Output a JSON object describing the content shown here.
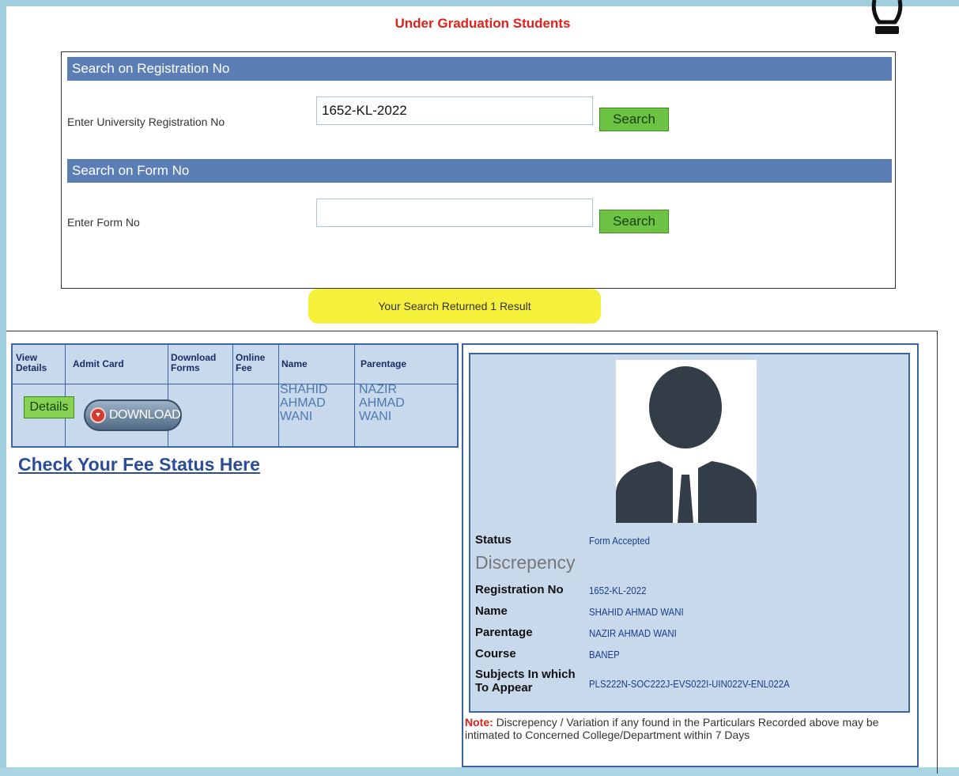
{
  "page": {
    "title": "Under Graduation Students"
  },
  "search_registration": {
    "heading": "Search on Registration No",
    "label": "Enter University Registration No",
    "value": "1652-KL-2022",
    "button": "Search"
  },
  "search_form": {
    "heading": "Search on Form No",
    "label": "Enter Form No",
    "value": "",
    "button": "Search"
  },
  "result_banner": "Your Search Returned 1 Result",
  "results_table": {
    "headers": [
      "View Details",
      "Admit Card",
      "Download Forms",
      "Online Fee",
      "Name",
      "Parentage"
    ],
    "row": {
      "details_button": "Details",
      "download_button": "DOWNLOAD",
      "name": "SHAHID AHMAD WANI",
      "parentage": "NAZIR AHMAD WANI"
    }
  },
  "fee_link": "Check Your Fee Status Here",
  "profile": {
    "status_label": "Status",
    "status_value": "Form Accepted",
    "discrepency": "Discrepency",
    "fields": [
      {
        "label": "Registration No",
        "value": "1652-KL-2022"
      },
      {
        "label": "Name",
        "value": "SHAHID AHMAD WANI"
      },
      {
        "label": "Parentage",
        "value": "NAZIR AHMAD WANI"
      },
      {
        "label": "Course",
        "value": "BANEP"
      },
      {
        "label": "Subjects In which To Appear",
        "value": "PLS222N-SOC222J-EVS022I-UIN022V-ENL022A"
      }
    ]
  },
  "note": {
    "label": "Note:",
    "text": "Discrepency / Variation if any found in the Particulars Recorded above may be intimated to Concerned College/Department within 7 Days"
  },
  "colors": {
    "title_red": "#e0221a",
    "section_blue": "#5b7fb5",
    "button_green": "#6cc344",
    "banner_yellow": "#f5f03a",
    "panel_blue": "#c9d9ec"
  },
  "icons": [
    "bulb-icon",
    "download-icon",
    "person-avatar-icon"
  ]
}
